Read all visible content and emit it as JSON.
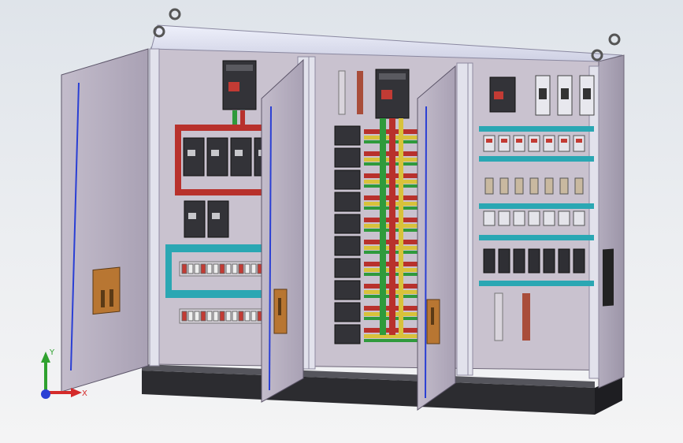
{
  "viewport": {
    "background_top": "#dfe4ea",
    "background_bottom": "#f4f4f5",
    "model": "electrical-control-cabinet-assembly"
  },
  "triad": {
    "x_label": "X",
    "y_label": "Y",
    "x_color": "#d42a2a",
    "y_color": "#2fa12f",
    "z_color": "#2a3fd4"
  },
  "colors": {
    "panel": "#c9c2cf",
    "door": "#b7afc2",
    "frame": "#e2e2ec",
    "base": "#2c2c30",
    "rail_cyan": "#2aa7b3",
    "busbar_red": "#b8312c",
    "busbar_green": "#2f9a3c",
    "busbar_yellow": "#d8c23a",
    "handle_orange": "#b87632",
    "breaker_dark": "#333338"
  }
}
